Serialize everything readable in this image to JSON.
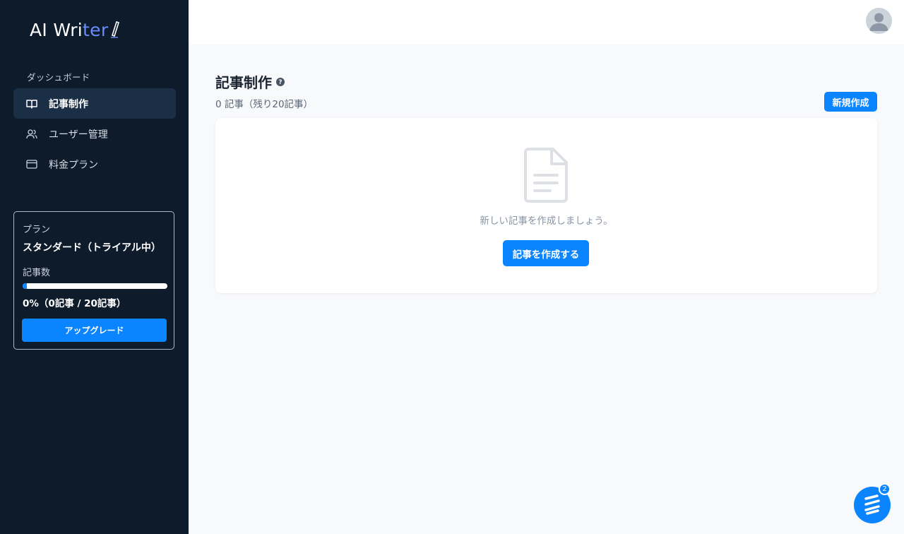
{
  "app": {
    "logo_text_main": "AI Wri",
    "logo_text_accent": "ter"
  },
  "sidebar": {
    "section_label": "ダッシュボード",
    "items": [
      {
        "label": "記事制作",
        "icon": "book-open-icon",
        "active": true
      },
      {
        "label": "ユーザー管理",
        "icon": "users-icon",
        "active": false
      },
      {
        "label": "料金プラン",
        "icon": "credit-card-icon",
        "active": false
      }
    ]
  },
  "plan": {
    "label": "プラン",
    "name": "スタンダード（トライアル中）",
    "count_label": "記事数",
    "progress_percent": 3,
    "progress_text": "0%（0記事 / 20記事）",
    "upgrade_label": "アップグレード"
  },
  "main": {
    "title": "記事制作",
    "subtitle": "0 記事（残り20記事）",
    "new_button": "新規作成",
    "empty_message": "新しい記事を作成しましょう。",
    "create_button": "記事を作成する"
  },
  "chat": {
    "badge_count": "2"
  },
  "colors": {
    "sidebar_bg": "#0d1b2a",
    "accent": "#0a84ff",
    "logo_accent": "#6a8cff"
  }
}
